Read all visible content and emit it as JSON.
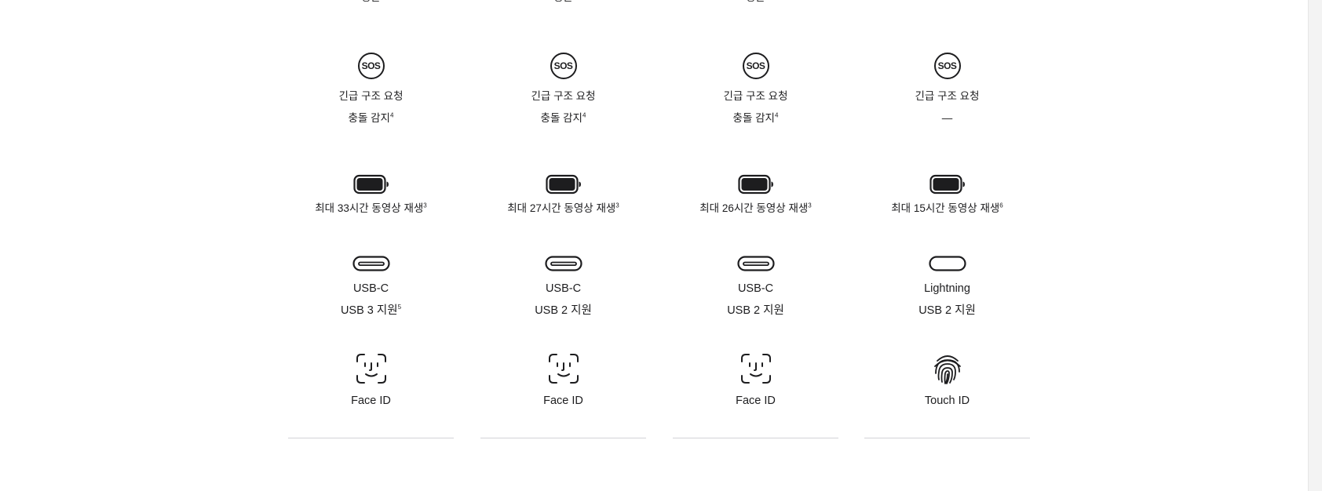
{
  "columns": [
    {
      "top_cut_text": "충돌",
      "sos": {
        "label": "긴급 구조 요청",
        "crash_detection": "충돌 감지",
        "crash_sup": "4",
        "icon_text": "SOS"
      },
      "battery": {
        "label": "최대 33시간 동영상 재생",
        "sup": "3"
      },
      "port": {
        "type": "USB-C",
        "spec": "USB 3 지원",
        "spec_sup": "5"
      },
      "auth": {
        "label": "Face ID",
        "icon": "face-id-icon"
      }
    },
    {
      "top_cut_text": "충돌",
      "sos": {
        "label": "긴급 구조 요청",
        "crash_detection": "충돌 감지",
        "crash_sup": "4",
        "icon_text": "SOS"
      },
      "battery": {
        "label": "최대 27시간 동영상 재생",
        "sup": "3"
      },
      "port": {
        "type": "USB-C",
        "spec": "USB 2 지원",
        "spec_sup": ""
      },
      "auth": {
        "label": "Face ID",
        "icon": "face-id-icon"
      }
    },
    {
      "top_cut_text": "충돌",
      "sos": {
        "label": "긴급 구조 요청",
        "crash_detection": "충돌 감지",
        "crash_sup": "4",
        "icon_text": "SOS"
      },
      "battery": {
        "label": "최대 26시간 동영상 재생",
        "sup": "3"
      },
      "port": {
        "type": "USB-C",
        "spec": "USB 2 지원",
        "spec_sup": ""
      },
      "auth": {
        "label": "Face ID",
        "icon": "face-id-icon"
      }
    },
    {
      "top_cut_text": "",
      "sos": {
        "label": "긴급 구조 요청",
        "crash_detection": "—",
        "crash_sup": "",
        "icon_text": "SOS"
      },
      "battery": {
        "label": "최대 15시간 동영상 재생",
        "sup": "6"
      },
      "port": {
        "type": "Lightning",
        "spec": "USB 2 지원",
        "spec_sup": ""
      },
      "auth": {
        "label": "Touch ID",
        "icon": "touch-id-icon"
      }
    }
  ],
  "colors": {
    "text": "#1d1d1f",
    "divider": "#d2d2d7",
    "background": "#ffffff"
  }
}
